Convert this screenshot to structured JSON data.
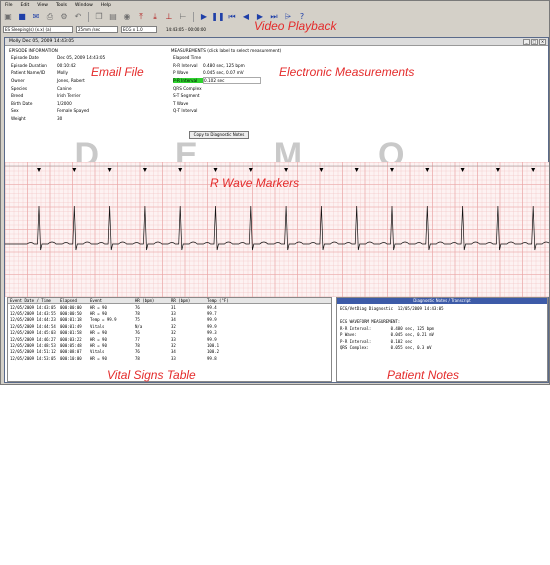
{
  "menu": [
    "File",
    "Edit",
    "View",
    "Tools",
    "Window",
    "Help"
  ],
  "toolbar": {
    "icons": [
      "open-icon",
      "save-icon",
      "email-icon",
      "print-icon",
      "settings-icon",
      "undo-icon",
      "copy-icon",
      "paste-icon",
      "eye-icon",
      "upload-icon",
      "download-icon",
      "marker-icon",
      "caliper-icon",
      "play-icon",
      "pause-icon",
      "rewind-icon",
      "step-back-icon",
      "step-forward-icon",
      "fast-forward-icon",
      "measure-icon",
      "help-icon"
    ]
  },
  "combos": {
    "file": "ES Sleeping(s) (x.x) (a)",
    "speed": "25mm /sec",
    "gain": "ECG x 1.0",
    "time": "14:43:05 - 00:00:00"
  },
  "labels": {
    "video_playback": "Video Playback",
    "email_file": "Email File",
    "electronic_measurements": "Electronic Measurements",
    "r_wave_markers": "R Wave Markers",
    "vital_signs_table": "Vital Signs Table",
    "patient_notes": "Patient Notes"
  },
  "doc_title": "Molly  Dec 05, 2009  14:43:05",
  "episode": {
    "header": "EPISODE INFORMATION",
    "rows": [
      {
        "k": "Episode Date",
        "v": "Dec 05, 2009  14:43:05"
      },
      {
        "k": "Episode Duration",
        "v": "00:10:42"
      },
      {
        "k": "Patient Name/ID",
        "v": "Molly"
      },
      {
        "k": "Owner",
        "v": "Jones, Robert"
      },
      {
        "k": "Species",
        "v": "Canine"
      },
      {
        "k": "Breed",
        "v": "Irish Terrier"
      },
      {
        "k": "Birth Date",
        "v": "1/2000"
      },
      {
        "k": "Sex",
        "v": "Female  Spayed"
      },
      {
        "k": "Weight",
        "v": "30"
      }
    ]
  },
  "measurements": {
    "header": "MEASUREMENTS (click label to select measurement)",
    "rows": [
      {
        "k": "Elapsed Time",
        "v": "",
        "hi": false
      },
      {
        "k": "R-R Interval",
        "v": "0.480 sec, 125 bpm",
        "hi": false
      },
      {
        "k": "P Wave",
        "v": "0.045 sec, 0.07 mV",
        "hi": false
      },
      {
        "k": "P-R Interval",
        "v": "0.102 sec",
        "hi": true
      },
      {
        "k": "QRS Complex",
        "v": "",
        "hi": false
      },
      {
        "k": "S-T Segment",
        "v": "",
        "hi": false
      },
      {
        "k": "T Wave",
        "v": "",
        "hi": false
      },
      {
        "k": "Q-T Interval",
        "v": "",
        "hi": false
      }
    ],
    "copy_button": "Copy to Diagnostic Notes"
  },
  "watermark": "DEMO",
  "vitals": {
    "headers": [
      "Event Date / Time",
      "Elapsed",
      "Event",
      "HR (bpm)",
      "RR (bpm)",
      "Temp (°F)"
    ],
    "rows": [
      [
        "12/05/2009 14:43:05",
        "000:00:00",
        "HR = 90",
        "76",
        "31",
        "99.4"
      ],
      [
        "12/05/2009 14:43:55",
        "000:00:50",
        "HR = 90",
        "78",
        "33",
        "99.7"
      ],
      [
        "12/05/2009 14:44:23",
        "000:01:18",
        "Temp = 99.9",
        "75",
        "34",
        "99.9"
      ],
      [
        "12/05/2009 14:44:54",
        "000:01:49",
        "Vitals",
        "N/a",
        "32",
        "99.9"
      ],
      [
        "12/05/2009 14:45:03",
        "000:01:58",
        "HR = 90",
        "76",
        "32",
        "99.3"
      ],
      [
        "12/05/2009 14:46:27",
        "000:03:22",
        "HR = 90",
        "77",
        "33",
        "99.9"
      ],
      [
        "12/05/2009 14:48:53",
        "000:05:48",
        "HR = 90",
        "78",
        "32",
        "100.1"
      ],
      [
        "12/05/2009 14:51:12",
        "000:08:07",
        "Vitals",
        "76",
        "34",
        "100.2"
      ],
      [
        "12/05/2009 14:53:05",
        "000:10:00",
        "HR = 90",
        "78",
        "33",
        "99.8"
      ]
    ]
  },
  "notes": {
    "title": "Diagnostic Notes / Transcript",
    "lines": [
      "ECG/VetDiag Diagnostic  12/05/2009 14:43:05",
      "",
      "ECG WAVEFORM MEASUREMENT:",
      "R-R Interval:        0.480 sec, 125 bpm",
      "P Wave:              0.045 sec, 0.21 mV",
      "P-R Interval:        0.102 sec",
      "QRS Complex:         0.055 sec, 0.3 mV"
    ]
  },
  "ecg": {
    "r_wave_count": 15
  }
}
